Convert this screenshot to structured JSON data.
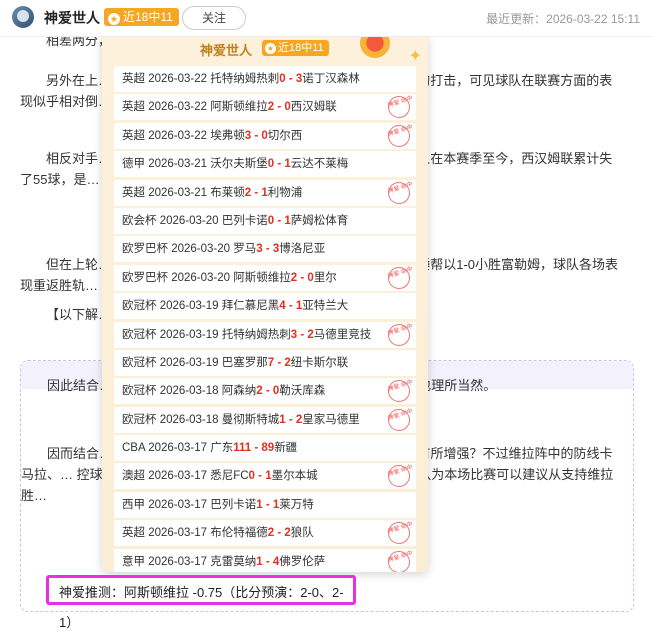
{
  "header": {
    "author": "神爱世人",
    "badge": "近18中11",
    "follow_label": "关注",
    "updated": "最近更新：2026-03-22 15:11"
  },
  "article": {
    "p0": "相差两分，由…",
    "p1": "另外在上…                                                  劲旅里尔成功晋级八强，球队士气方面得到不小…                                                 败的打击，可见球队在联赛方面的表现似乎相对倒…",
    "p2": "相反对手…                                                  分排名英超联赛的倒数第三名，不过球队与安全…                                                 而且在本赛季至今，西汉姆联累计失了55球，是…                                                  子漏洞百出。",
    "p3": "但在上轮…                                                  主场，球队在过去的三场赛事也能够保持不败的…                                                  铁锤帮以1-0小胜富勒姆，球队各场表现重返胜轨…",
    "p4": "【以下解…                                                  比赛两队详尽的数据解读，多维度给出合理参考…",
    "p5": "因此结合…                                                  场的阿斯顿维拉更具信心。毕竟球队近期联赛表…                                                  好也理所当然。",
    "p6": "因而结合…                                                  间浮动，而且其他数据维拉从让0.75球（主队…                                                  似乎有所增强？不过维拉阵中的防线卡马拉、…                                                  控球压迫，边路内切与中路渗透结合，但球队…                                                  况下，笔者认为本场比赛可以建议从支持维拉胜…"
  },
  "prediction": "神爱推测：阿斯顿维拉 -0.75（比分预演：2-0、2-1）",
  "overlay": {
    "title": "神爱世人",
    "badge": "近18中11",
    "stamp_text": "神爱 命中",
    "rows": [
      {
        "pre": "英超 2026-03-22 托特纳姆热刺",
        "s1": "0",
        "s2": "3",
        "post": "诺丁汉森林",
        "hit": false
      },
      {
        "pre": "英超 2026-03-22 阿斯顿维拉",
        "s1": "2",
        "s2": "0",
        "post": "西汉姆联",
        "hit": true
      },
      {
        "pre": "英超 2026-03-22 埃弗顿",
        "s1": "3",
        "s2": "0",
        "post": "切尔西",
        "hit": true
      },
      {
        "pre": "德甲 2026-03-21 沃尔夫斯堡",
        "s1": "0",
        "s2": "1",
        "post": "云达不莱梅",
        "hit": false
      },
      {
        "pre": "英超 2026-03-21 布莱顿",
        "s1": "2",
        "s2": "1",
        "post": "利物浦",
        "hit": true
      },
      {
        "pre": "欧会杯 2026-03-20 巴列卡诺",
        "s1": "0",
        "s2": "1",
        "post": "萨姆松体育",
        "hit": false
      },
      {
        "pre": "欧罗巴杯 2026-03-20 罗马",
        "s1": "3",
        "s2": "3",
        "post": "博洛尼亚",
        "hit": false
      },
      {
        "pre": "欧罗巴杯 2026-03-20 阿斯顿维拉",
        "s1": "2",
        "s2": "0",
        "post": "里尔",
        "hit": true
      },
      {
        "pre": "欧冠杯 2026-03-19 拜仁慕尼黑",
        "s1": "4",
        "s2": "1",
        "post": "亚特兰大",
        "hit": false
      },
      {
        "pre": "欧冠杯 2026-03-19 托特纳姆热刺",
        "s1": "3",
        "s2": "2",
        "post": "马德里竞技",
        "hit": true
      },
      {
        "pre": "欧冠杯 2026-03-19 巴塞罗那",
        "s1": "7",
        "s2": "2",
        "post": "纽卡斯尔联",
        "hit": false
      },
      {
        "pre": "欧冠杯 2026-03-18 阿森纳",
        "s1": "2",
        "s2": "0",
        "post": "勒沃库森",
        "hit": true
      },
      {
        "pre": "欧冠杯 2026-03-18 曼彻斯特城",
        "s1": "1",
        "s2": "2",
        "post": "皇家马德里",
        "hit": true
      },
      {
        "pre": "CBA 2026-03-17 广东",
        "s1": "111",
        "s2": "89",
        "post": "新疆",
        "hit": false
      },
      {
        "pre": "澳超 2026-03-17 悉尼FC",
        "s1": "0",
        "s2": "1",
        "post": "墨尔本城",
        "hit": true
      },
      {
        "pre": "西甲 2026-03-17 巴列卡诺",
        "s1": "1",
        "s2": "1",
        "post": "莱万特",
        "hit": false
      },
      {
        "pre": "英超 2026-03-17 布伦特福德",
        "s1": "2",
        "s2": "2",
        "post": "狼队",
        "hit": true
      },
      {
        "pre": "意甲 2026-03-17 克雷莫纳",
        "s1": "1",
        "s2": "4",
        "post": "佛罗伦萨",
        "hit": true
      }
    ]
  }
}
